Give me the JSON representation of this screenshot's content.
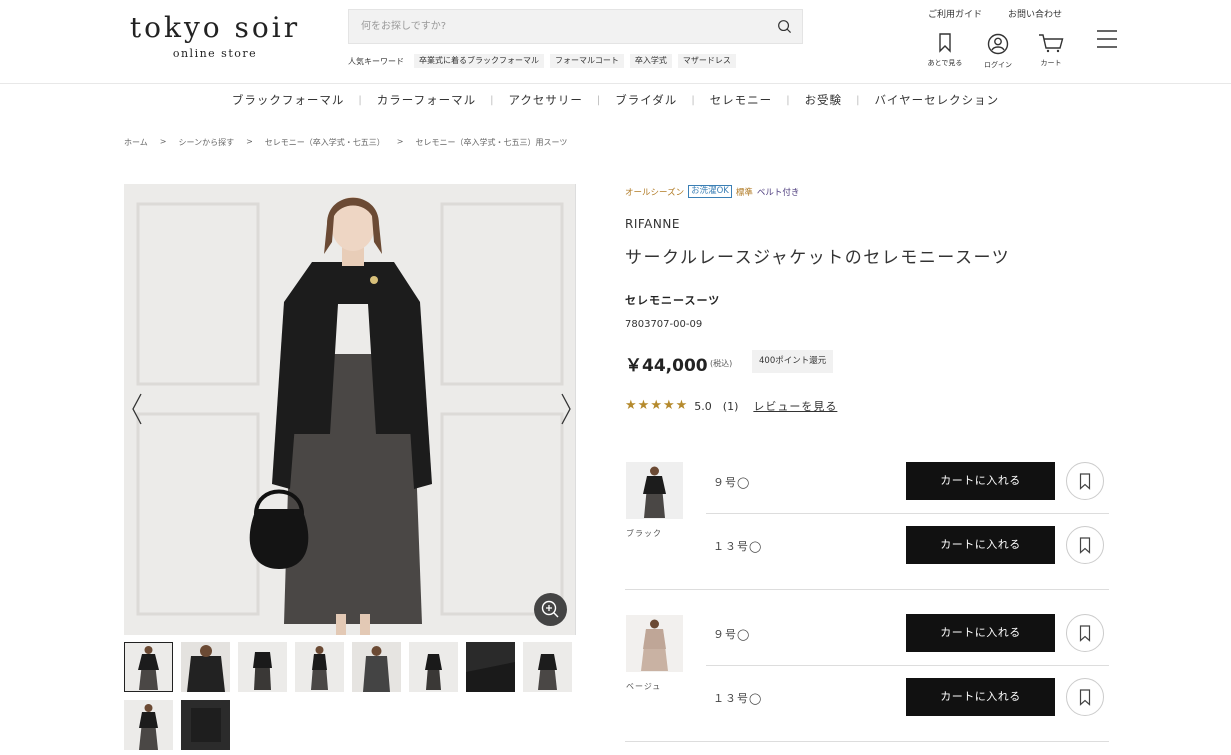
{
  "header": {
    "logo_main": "tokyo soir",
    "logo_sub": "online store",
    "search_placeholder": "何をお探しですか?",
    "keywords_label": "人気キーワード",
    "keywords": [
      "卒業式に着るブラックフォーマル",
      "フォーマルコート",
      "卒入学式",
      "マザードレス"
    ],
    "guide_link": "ご利用ガイド",
    "contact_link": "お問い合わせ",
    "later_label": "あとで見る",
    "login_label": "ログイン",
    "cart_label": "カート"
  },
  "nav": {
    "items": [
      "ブラックフォーマル",
      "カラーフォーマル",
      "アクセサリー",
      "ブライダル",
      "セレモニー",
      "お受験",
      "バイヤーセレクション"
    ]
  },
  "breadcrumb": [
    "ホーム",
    "シーンから探す",
    "セレモニー（卒入学式・七五三）",
    "セレモニー（卒入学式・七五三）用スーツ"
  ],
  "product": {
    "tags": {
      "season": "オールシーズン",
      "wash": "お洗濯OK",
      "fit": "標準",
      "belt": "ベルト付き"
    },
    "brand": "RIFANNE",
    "name": "サークルレースジャケットのセレモニースーツ",
    "category": "セレモニースーツ",
    "code": "7803707-00-09",
    "price": "￥44,000",
    "tax": "(税込)",
    "points": "400ポイント還元",
    "rating": "5.0",
    "review_count": "(1)",
    "review_link": "レビューを見る",
    "stars": 5
  },
  "variants": [
    {
      "color": "ブラック",
      "sizes": [
        {
          "label": "９号◯",
          "button": "カートに入れる"
        },
        {
          "label": "１３号◯",
          "button": "カートに入れる"
        }
      ]
    },
    {
      "color": "ベージュ",
      "sizes": [
        {
          "label": "９号◯",
          "button": "カートに入れる"
        },
        {
          "label": "１３号◯",
          "button": "カートに入れる"
        }
      ]
    }
  ],
  "colors": {
    "accent_gold": "#b58a2d",
    "button_black": "#111111",
    "wash_blue": "#3b7fb5"
  }
}
